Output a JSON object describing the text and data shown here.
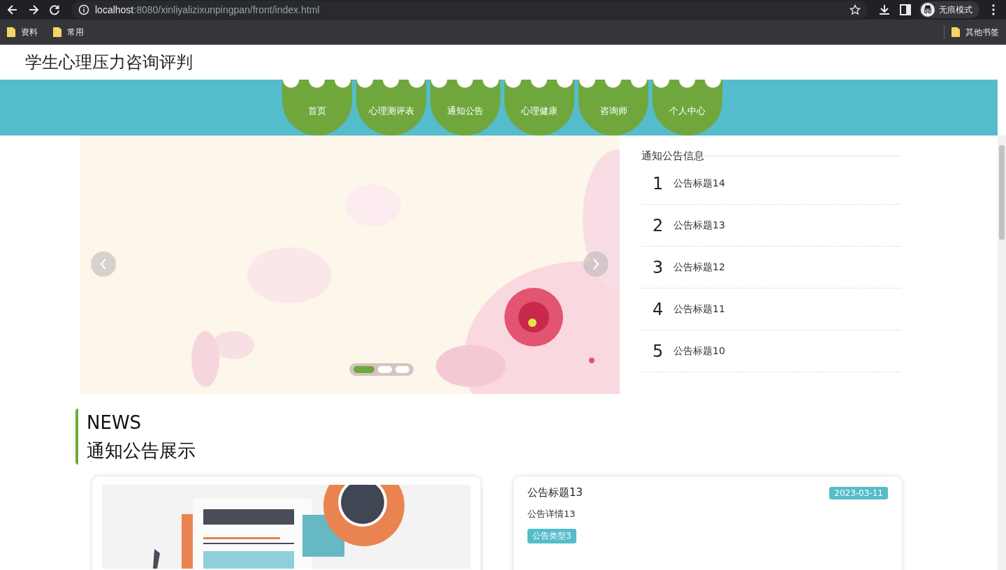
{
  "browser": {
    "url_host": "localhost",
    "url_path": ":8080/xinliyalizixunpingpan/front/index.html",
    "profile_label": "无痕模式",
    "bookmarks": [
      "资料",
      "常用"
    ],
    "other_bookmarks": "其他书签"
  },
  "site": {
    "title": "学生心理压力咨询评判"
  },
  "nav": [
    {
      "label": "首页"
    },
    {
      "label": "心理测评表"
    },
    {
      "label": "通知公告"
    },
    {
      "label": "心理健康"
    },
    {
      "label": "咨询师"
    },
    {
      "label": "个人中心"
    }
  ],
  "carousel": {
    "dots": [
      {
        "selected": true
      },
      {
        "selected": false
      },
      {
        "selected": false
      }
    ]
  },
  "notice_panel": {
    "title": "通知公告信息",
    "items": [
      {
        "index": "1",
        "title": "公告标题14"
      },
      {
        "index": "2",
        "title": "公告标题13"
      },
      {
        "index": "3",
        "title": "公告标题12"
      },
      {
        "index": "4",
        "title": "公告标题11"
      },
      {
        "index": "5",
        "title": "公告标题10"
      }
    ]
  },
  "news_section": {
    "heading_en": "NEWS",
    "heading": "通知公告展示"
  },
  "news_card": {
    "title": "公告标题13",
    "date": "2023-03-11",
    "detail": "公告详情13",
    "type": "公告类型3"
  }
}
